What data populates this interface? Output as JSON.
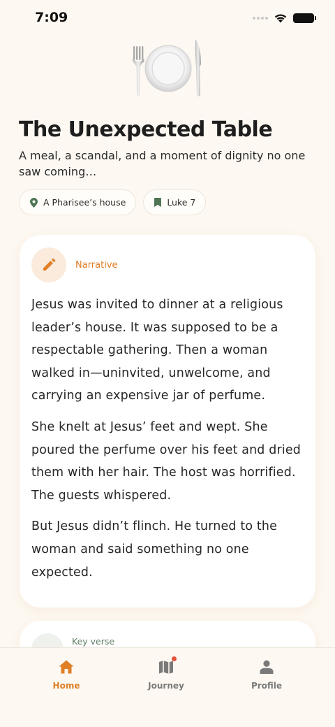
{
  "status_bar": {
    "time": "7:09"
  },
  "hero": {
    "icon": "fork-plate-knife-icon",
    "title": "The Unexpected Table",
    "subtitle": "A meal, a scandal, and a moment of dignity no one saw coming…"
  },
  "chips": [
    {
      "icon": "location-pin-icon",
      "label": "A Pharisee’s house"
    },
    {
      "icon": "bookmark-icon",
      "label": "Luke 7"
    }
  ],
  "narrative_card": {
    "icon": "pencil-icon",
    "kind": "Narrative",
    "paragraphs": [
      "Jesus was invited to dinner at a religious leader’s house. It was supposed to be a respectable gathering. Then a woman walked in—uninvited, unwelcome, and carrying an expensive jar of perfume.",
      "She knelt at Jesus’ feet and wept. She poured the perfume over his feet and dried them with her hair. The host was horrified. The guests whispered.",
      "But Jesus didn’t flinch. He turned to the woman and said something no one expected."
    ]
  },
  "verse_card": {
    "kind": "Key verse"
  },
  "tab_bar": {
    "tabs": [
      {
        "label": "Home",
        "icon": "home-icon",
        "active": true
      },
      {
        "label": "Journey",
        "icon": "map-icon",
        "active": false,
        "has_notification": true
      },
      {
        "label": "Profile",
        "icon": "person-icon",
        "active": false
      }
    ]
  },
  "colors": {
    "accent": "#e07f26",
    "background": "#fdf8f1",
    "card": "#ffffff",
    "secondary_accent": "#5f7f63",
    "notification": "#e5533a"
  }
}
